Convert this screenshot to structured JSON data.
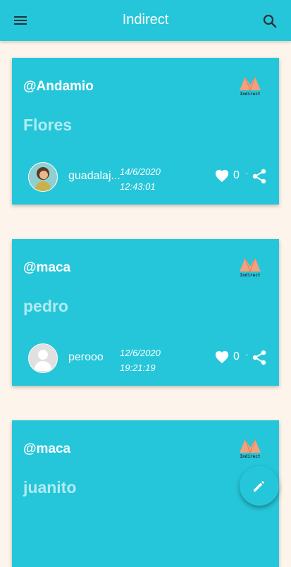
{
  "appbar": {
    "title": "Indirect",
    "menu_icon": "menu-icon",
    "search_icon": "search-icon"
  },
  "colors": {
    "primary": "#26c6da",
    "background": "#fdf5ec",
    "post_title": "#b2ebf2",
    "logo_accent": "#f4a07a"
  },
  "brand_logo_text": "Indirect",
  "posts": [
    {
      "author": "@Andamio",
      "title": "Flores",
      "username": "guadalaj...",
      "date": "14/6/2020",
      "time": "12:43:01",
      "likes": "0",
      "separator": "·"
    },
    {
      "author": "@maca",
      "title": "pedro",
      "username": "perooo",
      "date": "12/6/2020",
      "time": "19:21:19",
      "likes": "0",
      "separator": "·"
    },
    {
      "author": "@maca",
      "title": "juanito"
    }
  ],
  "fab": {
    "icon": "edit-pencil-icon"
  }
}
